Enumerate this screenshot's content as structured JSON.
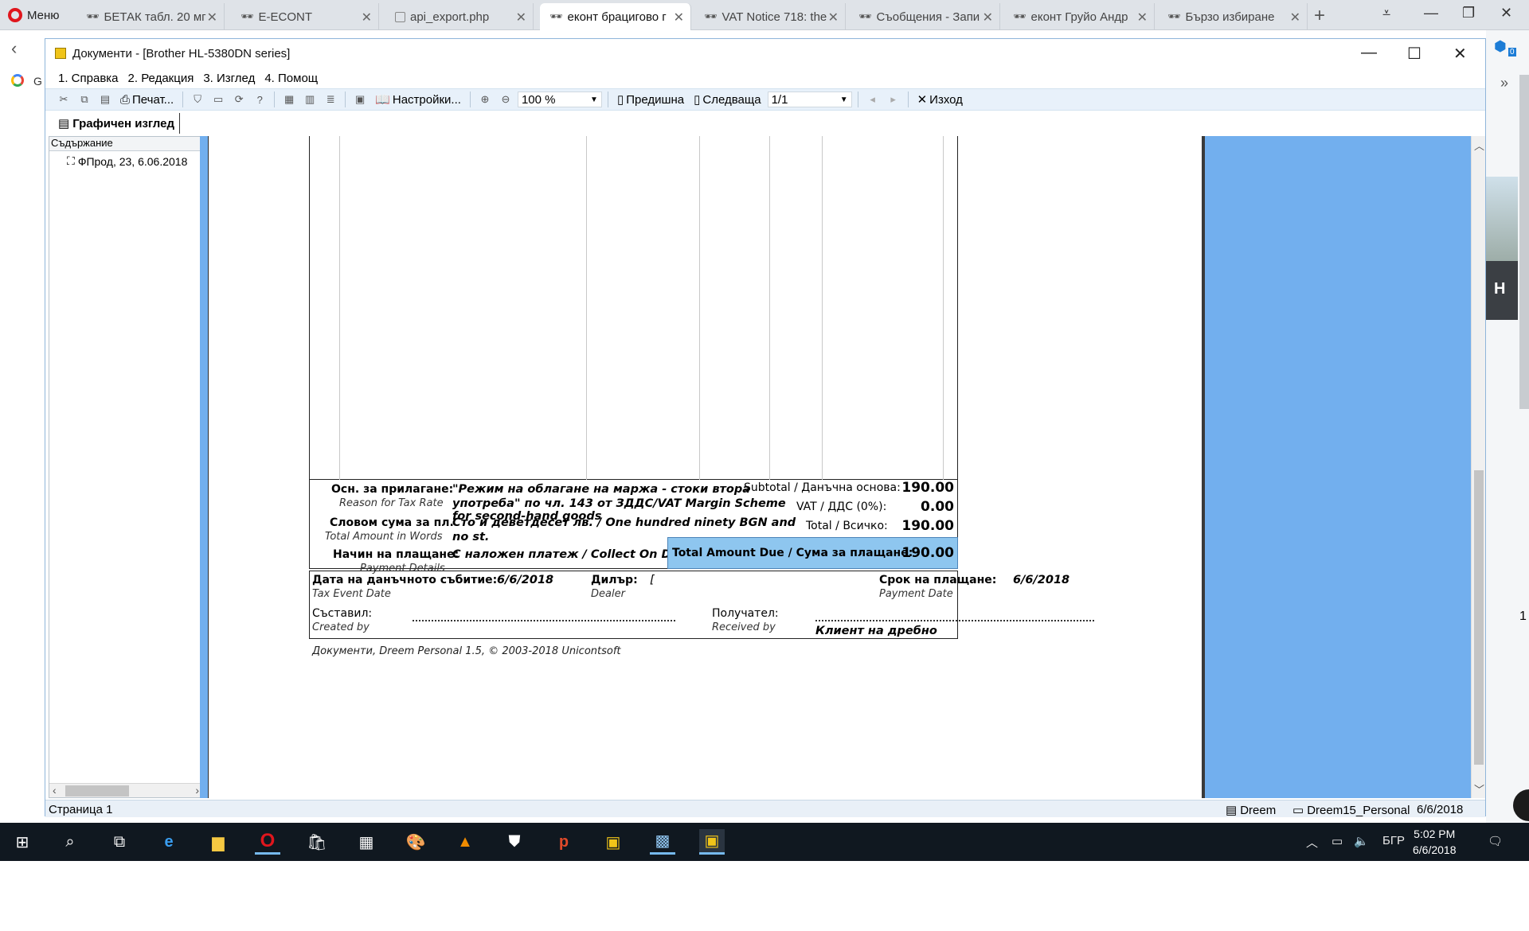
{
  "browser": {
    "menu_label": "Меню",
    "tabs": [
      {
        "title": "БЕТАК табл. 20 мг",
        "active": false
      },
      {
        "title": "E-ECONT",
        "active": false
      },
      {
        "title": "api_export.php",
        "active": false
      },
      {
        "title": "еконт брацигово г",
        "active": true
      },
      {
        "title": "VAT Notice 718: the",
        "active": false
      },
      {
        "title": "Съобщения - Запи",
        "active": false
      },
      {
        "title": "еконт Груйо Андр",
        "active": false
      },
      {
        "title": "Бързо избиране",
        "active": false
      }
    ],
    "google_label": "G",
    "right_edge_letter": "H",
    "right_edge_number": "1",
    "right_edge_badge": "0"
  },
  "window": {
    "title": "Документи - [Brother HL-5380DN series]",
    "menu": [
      "1. Справка",
      "2. Редакция",
      "3. Изглед",
      "4. Помощ"
    ],
    "toolbar": {
      "print_label": "Печат...",
      "settings_label": "Настройки...",
      "zoom_value": "100 %",
      "prev_label": "Предишна",
      "next_label": "Следваща",
      "page_value": "1/1",
      "exit_label": "Изход"
    },
    "view_tab": "Графичен изглед",
    "sidebar": {
      "header": "Съдържание",
      "node": "ФПрод, 23, 6.06.2018"
    },
    "status": {
      "page": "Страница 1",
      "db": "Dreem",
      "user": "Dreem15_Personal",
      "date": "6/6/2018"
    }
  },
  "invoice": {
    "basis_label": "Осн. за прилагане:",
    "basis_sub": "Reason for Tax Rate",
    "basis_value_line1": "\"Режим на облагане на маржа - стоки втора",
    "basis_value_line2": "употреба\" по чл. 143 от ЗДДС/VAT Margin Scheme",
    "basis_value_line3": "for second-hand goods",
    "words_label": "Словом сума за пл.",
    "words_sub": "Total Amount in Words",
    "words_value_line1": "Сто и деветдесет лв. / One hundred ninety BGN and",
    "words_value_line2": "no st.",
    "payment_label": "Начин на плащане:",
    "payment_sub": "Payment Details",
    "payment_value": "С наложен платеж / Collect On Delivery",
    "subtotal_label": "Subtotal / Данъчна основа:",
    "subtotal_value": "190.00",
    "vat_label": "VAT / ДДС  (0%):",
    "vat_value": "0.00",
    "total_label": "Total / Всичко:",
    "total_value": "190.00",
    "due_label": "Total Amount Due / Сума за плащане:",
    "due_value": "190.00",
    "tax_date_label": "Дата на данъчното събитие:",
    "tax_date_sub": "Tax Event Date",
    "tax_date_value": "6/6/2018",
    "dealer_label": "Дилър:",
    "dealer_sub": "Dealer",
    "dealer_value": "[",
    "pay_date_label": "Срок на плащане:",
    "pay_date_sub": "Payment Date",
    "pay_date_value": "6/6/2018",
    "created_label": "Съставил:",
    "created_sub": "Created by",
    "received_label": "Получател:",
    "received_sub": "Received by",
    "received_value": "Клиент на дребно",
    "footer": "Документи, Dreem Personal 1.5, © 2003-2018 Unicontsoft"
  },
  "taskbar": {
    "language": "БГР",
    "time": "5:02 PM",
    "date": "6/6/2018"
  }
}
